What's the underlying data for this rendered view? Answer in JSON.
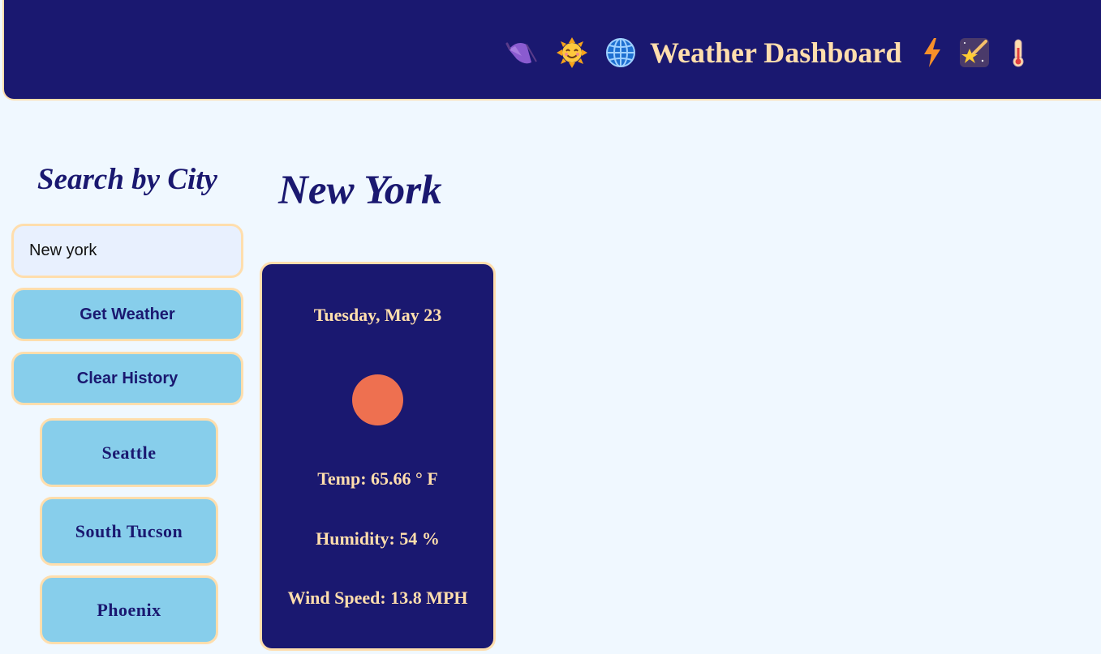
{
  "header": {
    "title": "Weather Dashboard",
    "icons_left": [
      "umbrella-icon",
      "sun-face-icon",
      "globe-icon"
    ],
    "icons_right": [
      "lightning-icon",
      "shooting-star-icon",
      "thermometer-icon"
    ]
  },
  "sidebar": {
    "heading": "Search by City",
    "search_value": "New york",
    "get_weather_label": "Get Weather",
    "clear_history_label": "Clear History",
    "history": [
      "Seattle",
      "South Tucson",
      "Phoenix"
    ]
  },
  "main": {
    "city": "New York",
    "card": {
      "date": "Tuesday, May 23",
      "weather_icon": "sun-icon",
      "temp": "Temp: 65.66 ° F",
      "humidity": "Humidity: 54 %",
      "wind": "Wind Speed: 13.8 MPH"
    }
  },
  "colors": {
    "navy": "#1a1870",
    "peach": "#ffdead",
    "sky": "#87ceeb",
    "background": "#f0f8ff",
    "sun": "#ee7050"
  }
}
